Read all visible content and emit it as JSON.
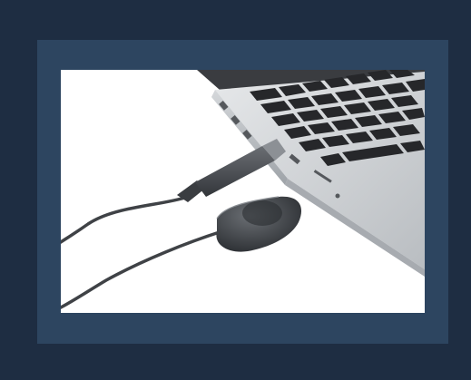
{
  "colors": {
    "outer_frame": "#1e2d42",
    "inner_frame": "#2d4560",
    "photo_background": "#ffffff",
    "laptop_body": "#c9cccf",
    "keyboard_keys": "#2a2b2e",
    "cable_and_sensor": "#4a4d51"
  },
  "photo": {
    "subject": "usb-dental-xray-sensor-connected-to-laptop"
  }
}
